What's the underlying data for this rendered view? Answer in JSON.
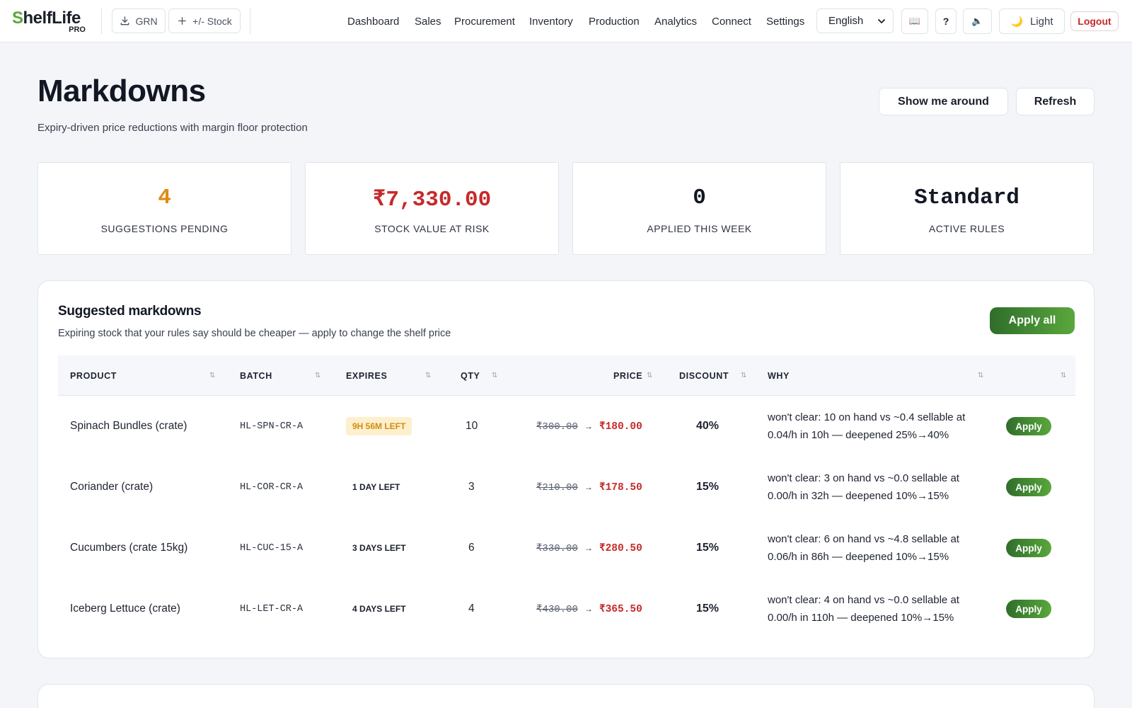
{
  "app": {
    "logo_main": "helfLife",
    "logo_s": "S",
    "logo_pro": "PRO"
  },
  "toolbar": {
    "grn_label": "GRN",
    "stock_label": "+/- Stock"
  },
  "nav": {
    "items": [
      "Dashboard",
      "Sales",
      "Procurement",
      "Inventory",
      "Production",
      "Analytics",
      "Connect",
      "Settings"
    ],
    "language": "English",
    "book_icon": "📖",
    "help_label": "?",
    "sound_icon": "🔈",
    "theme_icon": "🌙",
    "theme_label": "Light",
    "logout_label": "Logout"
  },
  "page": {
    "title": "Markdowns",
    "subtitle": "Expiry-driven price reductions with margin floor protection",
    "tour_label": "Show me around",
    "refresh_label": "Refresh"
  },
  "stats": [
    {
      "value": "4",
      "label": "SUGGESTIONS PENDING",
      "color": "#e08a12"
    },
    {
      "value": "₹7,330.00",
      "label": "STOCK VALUE AT RISK",
      "color": "#c62a2a"
    },
    {
      "value": "0",
      "label": "APPLIED THIS WEEK",
      "color": "#121724"
    },
    {
      "value": "Standard",
      "label": "ACTIVE RULES",
      "color": "#121724"
    }
  ],
  "suggestions": {
    "title": "Suggested markdowns",
    "subtitle": "Expiring stock that your rules say should be cheaper — apply to change the shelf price",
    "apply_all_label": "Apply all",
    "columns": {
      "product": "PRODUCT",
      "batch": "BATCH",
      "expires": "EXPIRES",
      "qty": "QTY",
      "price": "PRICE",
      "discount": "DISCOUNT",
      "why": "WHY"
    },
    "sort_icon": "⇅",
    "arrow": "→",
    "rows": [
      {
        "product": "Spinach Bundles (crate)",
        "batch": "HL-SPN-CR-A",
        "expires": "9H 56M LEFT",
        "urgent": true,
        "qty": "10",
        "old_price": "₹300.00",
        "new_price": "₹180.00",
        "discount": "40%",
        "why": "won't clear: 10 on hand vs ~0.4 sellable at 0.04/h in 10h — deepened 25%→40%",
        "apply_label": "Apply"
      },
      {
        "product": "Coriander (crate)",
        "batch": "HL-COR-CR-A",
        "expires": "1 DAY LEFT",
        "urgent": false,
        "qty": "3",
        "old_price": "₹210.00",
        "new_price": "₹178.50",
        "discount": "15%",
        "why": "won't clear: 3 on hand vs ~0.0 sellable at 0.00/h in 32h — deepened 10%→15%",
        "apply_label": "Apply"
      },
      {
        "product": "Cucumbers (crate 15kg)",
        "batch": "HL-CUC-15-A",
        "expires": "3 DAYS LEFT",
        "urgent": false,
        "qty": "6",
        "old_price": "₹330.00",
        "new_price": "₹280.50",
        "discount": "15%",
        "why": "won't clear: 6 on hand vs ~4.8 sellable at 0.06/h in 86h — deepened 10%→15%",
        "apply_label": "Apply"
      },
      {
        "product": "Iceberg Lettuce (crate)",
        "batch": "HL-LET-CR-A",
        "expires": "4 DAYS LEFT",
        "urgent": false,
        "qty": "4",
        "old_price": "₹430.00",
        "new_price": "₹365.50",
        "discount": "15%",
        "why": "won't clear: 4 on hand vs ~0.0 sellable at 0.00/h in 110h — deepened 10%→15%",
        "apply_label": "Apply"
      }
    ]
  }
}
